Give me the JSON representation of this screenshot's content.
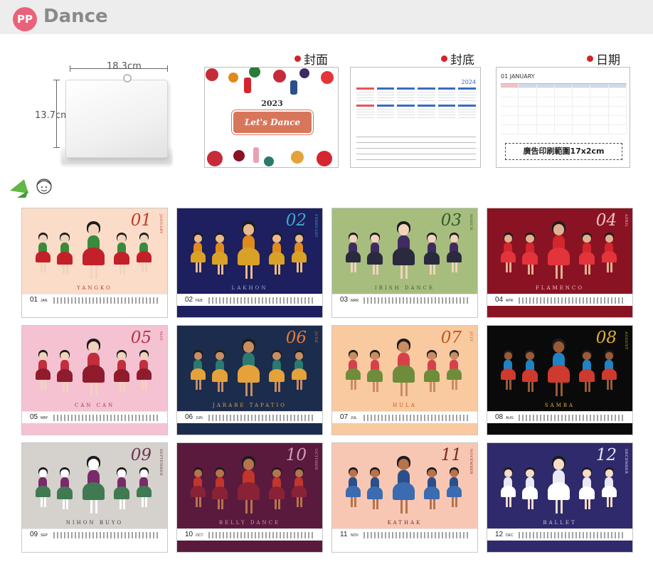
{
  "header": {
    "badge": "PP",
    "title": "Dance"
  },
  "product": {
    "width_label": "18.3cm",
    "height_label": "13.7cm"
  },
  "previews": [
    {
      "label": "封面"
    },
    {
      "label": "封底"
    },
    {
      "label": "日期"
    }
  ],
  "cover": {
    "year": "2023",
    "title": "Let's Dance"
  },
  "back": {
    "year": "2024"
  },
  "date_page": {
    "month": "01 JANUARY",
    "ad_text": "廣告印刷範圍17x2cm"
  },
  "colors": {
    "accent": "#d2232a",
    "brand": "#e8637a"
  },
  "months": [
    {
      "num": "01",
      "abbr": "JAN",
      "side": "JANUARY",
      "dance": "YANGKO",
      "bg": "#fbdcc8",
      "num_color": "#c0392b",
      "foot": "#ffffff",
      "skin": "#f1d3bd",
      "outfit": "#3a8a3c",
      "skirt": "#c4202a",
      "name_color": "#b63a3a"
    },
    {
      "num": "02",
      "abbr": "FEB",
      "side": "FEBRUARY",
      "dance": "LAKHON",
      "bg": "#1d1f5e",
      "num_color": "#3fa9c9",
      "foot": "#1d1f5e",
      "skin": "#e9b98d",
      "outfit": "#e08a1c",
      "skirt": "#d9a227",
      "name_color": "#9bb2d9"
    },
    {
      "num": "03",
      "abbr": "MAR",
      "side": "MARCH",
      "dance": "IRISH DANCE",
      "bg": "#a7bd7e",
      "num_color": "#2f5a2c",
      "foot": "#ffffff",
      "skin": "#f1d3bd",
      "outfit": "#3f2b62",
      "skirt": "#2a2a3e",
      "name_color": "#3f5a2c"
    },
    {
      "num": "04",
      "abbr": "APR",
      "side": "APRIL",
      "dance": "FLAMENCO",
      "bg": "#8a1323",
      "num_color": "#f2c2c6",
      "foot": "#8a1323",
      "skin": "#e2b08e",
      "outfit": "#d3262f",
      "skirt": "#e3343b",
      "name_color": "#f2c2c6"
    },
    {
      "num": "05",
      "abbr": "MAY",
      "side": "MAY",
      "dance": "CAN CAN",
      "bg": "#f5c2d2",
      "num_color": "#b0344c",
      "foot": "#f5c2d2",
      "skin": "#f1d3bd",
      "outfit": "#c22e3e",
      "skirt": "#8f1c2d",
      "name_color": "#b0344c"
    },
    {
      "num": "06",
      "abbr": "JUN",
      "side": "JUNE",
      "dance": "JARABE TAPATIO",
      "bg": "#1c2c4d",
      "num_color": "#e47a3a",
      "foot": "#1c2c4d",
      "skin": "#c98d63",
      "outfit": "#2b7a6f",
      "skirt": "#e5a23a",
      "name_color": "#e5a23a"
    },
    {
      "num": "07",
      "abbr": "JUL",
      "side": "JULY",
      "dance": "HULA",
      "bg": "#f9c9a0",
      "num_color": "#c0571d",
      "foot": "#f9c9a0",
      "skin": "#c98d63",
      "outfit": "#d7404b",
      "skirt": "#6e8c3a",
      "name_color": "#c0571d"
    },
    {
      "num": "08",
      "abbr": "AUG",
      "side": "AUGUST",
      "dance": "SAMBA",
      "bg": "#0a0a0a",
      "num_color": "#e3b12f",
      "foot": "#0a0a0a",
      "skin": "#9a5a36",
      "outfit": "#1f83c4",
      "skirt": "#cf3a2e",
      "name_color": "#e3b12f"
    },
    {
      "num": "09",
      "abbr": "SEP",
      "side": "SEPTEMBER",
      "dance": "NIHON BUYO",
      "bg": "#d5d1cd",
      "num_color": "#6b3550",
      "foot": "#ffffff",
      "skin": "#ffffff",
      "outfit": "#7a2a6b",
      "skirt": "#3f7a52",
      "name_color": "#444444"
    },
    {
      "num": "10",
      "abbr": "OCT",
      "side": "OCTOBER",
      "dance": "BELLY DANCE",
      "bg": "#5a1a3e",
      "num_color": "#d49ab5",
      "foot": "#5a1a3e",
      "skin": "#b7734b",
      "outfit": "#c2352b",
      "skirt": "#8a2236",
      "name_color": "#d49ab5"
    },
    {
      "num": "11",
      "abbr": "NOV",
      "side": "NOVEMBER",
      "dance": "KATHAK",
      "bg": "#f8c7b3",
      "num_color": "#7b2a2a",
      "foot": "#ffffff",
      "skin": "#b7734b",
      "outfit": "#2a4f8a",
      "skirt": "#3b6bb0",
      "name_color": "#7b2a2a"
    },
    {
      "num": "12",
      "abbr": "DEC",
      "side": "DECEMBER",
      "dance": "BALLET",
      "bg": "#2f2a6b",
      "num_color": "#e0e4f5",
      "foot": "#2f2a6b",
      "skin": "#f6dcc9",
      "outfit": "#e9e9f6",
      "skirt": "#ffffff",
      "name_color": "#c8c8ea"
    }
  ]
}
